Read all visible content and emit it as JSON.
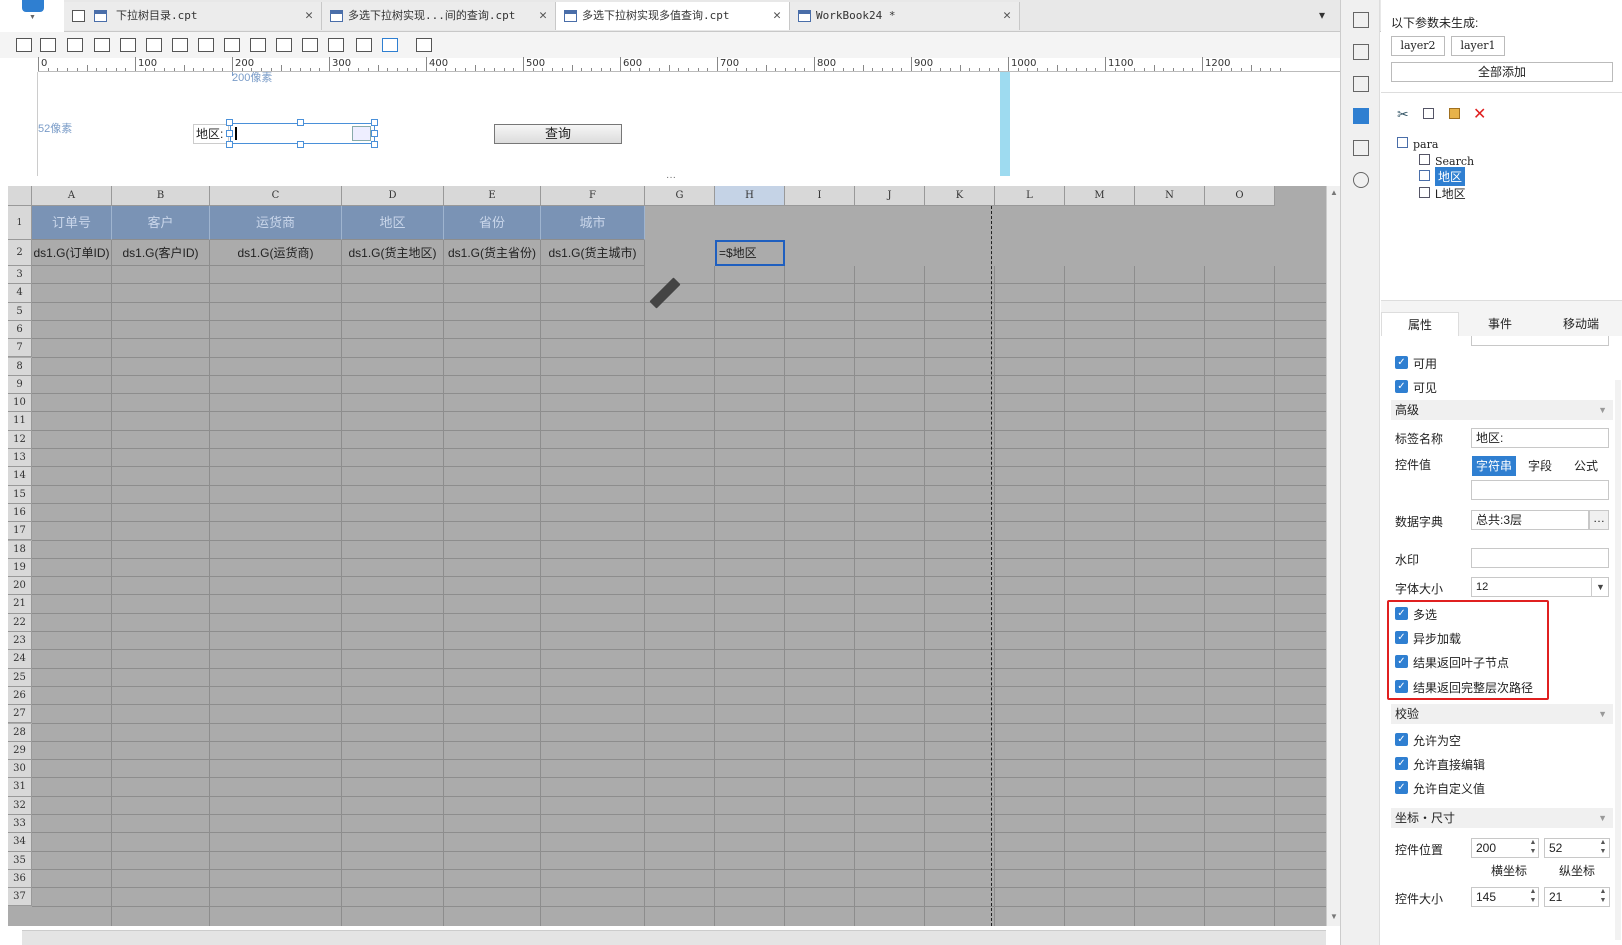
{
  "tabs": [
    {
      "label": "下拉树目录.cpt",
      "active": false
    },
    {
      "label": "多选下拉树实现...间的查询.cpt",
      "active": false
    },
    {
      "label": "多选下拉树实现多值查询.cpt",
      "active": true
    },
    {
      "label": "WorkBook24 *",
      "active": false
    }
  ],
  "ruler": {
    "labels": [
      "0",
      "100",
      "200",
      "300",
      "400",
      "500",
      "600",
      "700",
      "800",
      "900",
      "1000",
      "1100",
      "1200"
    ]
  },
  "param": {
    "x_label": "200像素",
    "y_label": "52像素",
    "field_label": "地区:",
    "query_button": "查询"
  },
  "grid": {
    "columns": [
      "A",
      "B",
      "C",
      "D",
      "E",
      "F",
      "G",
      "H",
      "I",
      "J",
      "K",
      "L",
      "M",
      "N",
      "O"
    ],
    "header_row_label": "1 (H)",
    "headers": [
      "订单号",
      "客户",
      "运货商",
      "地区",
      "省份",
      "城市"
    ],
    "row2": [
      "ds1.G(订单ID)",
      "ds1.G(客户ID)",
      "ds1.G(运货商)",
      "ds1.G(货主地区)",
      "ds1.G(货主省份)",
      "ds1.G(货主城市)"
    ],
    "h2_formula": "=$地区",
    "row_numbers": [
      "2",
      "3",
      "4",
      "5",
      "6",
      "7",
      "8",
      "9",
      "10",
      "11",
      "12",
      "13",
      "14",
      "15",
      "16",
      "17",
      "18",
      "19",
      "20",
      "21",
      "22",
      "23",
      "24",
      "25",
      "26",
      "27",
      "28",
      "29",
      "30",
      "31",
      "32",
      "33",
      "34",
      "35",
      "36",
      "37"
    ]
  },
  "panel": {
    "ungenerated_title": "以下参数未生成:",
    "params": [
      "layer2",
      "layer1"
    ],
    "add_all": "全部添加",
    "tree": {
      "root": "para",
      "items": [
        "Search",
        "地区",
        "L地区"
      ]
    },
    "tabs": [
      "属性",
      "事件",
      "移动端"
    ],
    "checks_top": [
      {
        "label": "可用",
        "checked": true
      },
      {
        "label": "可见",
        "checked": true
      }
    ],
    "advanced_section": "高级",
    "label_name_label": "标签名称",
    "label_name_value": "地区:",
    "control_value_label": "控件值",
    "control_value_options": [
      "字符串",
      "字段",
      "公式"
    ],
    "dict_label": "数据字典",
    "dict_value": "总共:3层",
    "watermark_label": "水印",
    "fontsize_label": "字体大小",
    "fontsize_value": "12",
    "highlighted_checks": [
      {
        "label": "多选",
        "checked": true
      },
      {
        "label": "异步加载",
        "checked": true
      },
      {
        "label": "结果返回叶子节点",
        "checked": true
      },
      {
        "label": "结果返回完整层次路径",
        "checked": true
      }
    ],
    "validate_section": "校验",
    "validate_checks": [
      {
        "label": "允许为空",
        "checked": true
      },
      {
        "label": "允许直接编辑",
        "checked": true
      },
      {
        "label": "允许自定义值",
        "checked": true
      }
    ],
    "geometry_section": "坐标・尺寸",
    "position_label": "控件位置",
    "pos_x": "200",
    "pos_y": "52",
    "pos_x_label": "横坐标",
    "pos_y_label": "纵坐标",
    "size_label": "控件大小",
    "size_w": "145",
    "size_h": "21"
  },
  "colors": {
    "header_fill": "#7a93b5",
    "highlight_box": "#e02020",
    "selection": "#1f5fbf",
    "checkbox": "#2f7fd1"
  }
}
